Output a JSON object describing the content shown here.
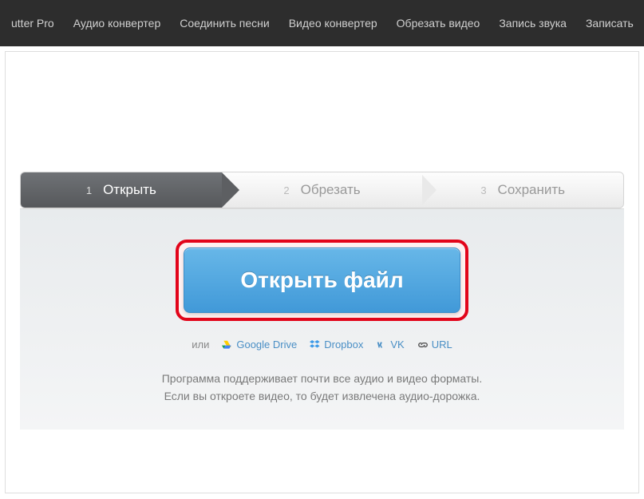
{
  "topnav": {
    "items": [
      "utter Pro",
      "Аудио конвертер",
      "Соединить песни",
      "Видео конвертер",
      "Обрезать видео",
      "Запись звука",
      "Записать"
    ]
  },
  "steps": [
    {
      "num": "1",
      "label": "Открыть"
    },
    {
      "num": "2",
      "label": "Обрезать"
    },
    {
      "num": "3",
      "label": "Сохранить"
    }
  ],
  "main": {
    "open_file_label": "Открыть файл",
    "or_label": "или",
    "alt_links": {
      "gdrive": "Google Drive",
      "dropbox": "Dropbox",
      "vk": "VK",
      "url": "URL"
    },
    "desc_line1": "Программа поддерживает почти все аудио и видео форматы.",
    "desc_line2": "Если вы откроете видео, то будет извлечена аудио-дорожка."
  }
}
